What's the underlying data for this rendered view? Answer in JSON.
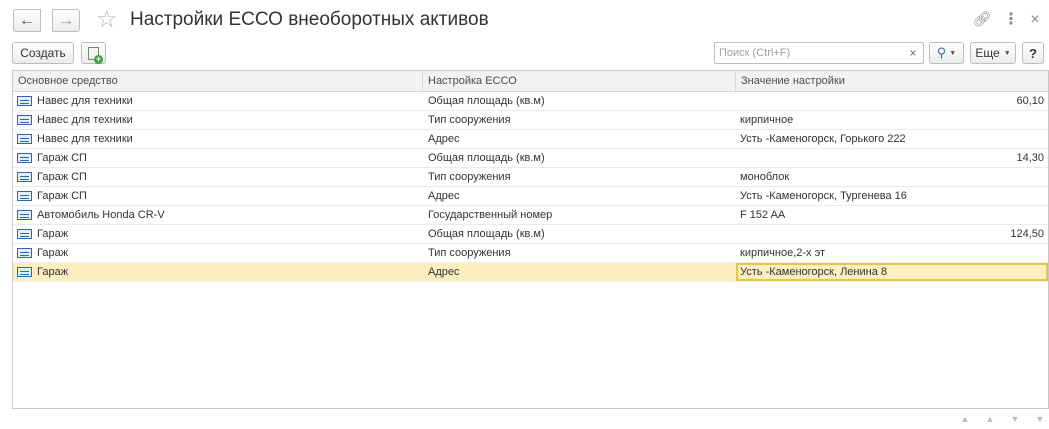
{
  "window": {
    "title": "Настройки ЕССО внеоборотных активов"
  },
  "toolbar": {
    "create_label": "Создать",
    "search_placeholder": "Поиск (Ctrl+F)",
    "more_label": "Еще",
    "help_label": "?"
  },
  "icons": {
    "back": "arrow-left-icon",
    "forward": "arrow-right-icon",
    "favorite": "star-icon",
    "link": "link-icon",
    "menu": "more-vertical-icon",
    "close": "close-icon",
    "copy": "copy-add-icon",
    "search": "search-icon",
    "row": "fixed-asset-icon"
  },
  "table": {
    "columns": [
      "Основное средство",
      "Настройка ЕССО",
      "Значение настройки"
    ],
    "rows": [
      {
        "asset": "Навес для техники",
        "setting": "Общая площадь (кв.м)",
        "value": "60,10",
        "numeric": true
      },
      {
        "asset": "Навес для техники",
        "setting": "Тип сооружения",
        "value": "кирпичное",
        "numeric": false
      },
      {
        "asset": "Навес для техники",
        "setting": "Адрес",
        "value": "Усть -Каменогорск, Горького 222",
        "numeric": false
      },
      {
        "asset": "Гараж СП",
        "setting": "Общая площадь (кв.м)",
        "value": "14,30",
        "numeric": true
      },
      {
        "asset": "Гараж СП",
        "setting": "Тип сооружения",
        "value": "моноблок",
        "numeric": false
      },
      {
        "asset": "Гараж СП",
        "setting": "Адрес",
        "value": "Усть -Каменогорск, Тургенева 16",
        "numeric": false
      },
      {
        "asset": "Автомобиль Honda CR-V",
        "setting": "Государственный номер",
        "value": "F 152 AA",
        "numeric": false
      },
      {
        "asset": "Гараж",
        "setting": "Общая площадь (кв.м)",
        "value": "124,50",
        "numeric": true
      },
      {
        "asset": "Гараж",
        "setting": "Тип сооружения",
        "value": "кирпичное,2-х эт",
        "numeric": false
      },
      {
        "asset": "Гараж",
        "setting": "Адрес",
        "value": "Усть -Каменогорск, Ленина 8",
        "numeric": false
      }
    ],
    "selected_row": 9
  },
  "colors": {
    "selected_row": "#fbeec0",
    "selected_cell_border": "#e8c54a",
    "header_bg": "#f2f2f2"
  }
}
